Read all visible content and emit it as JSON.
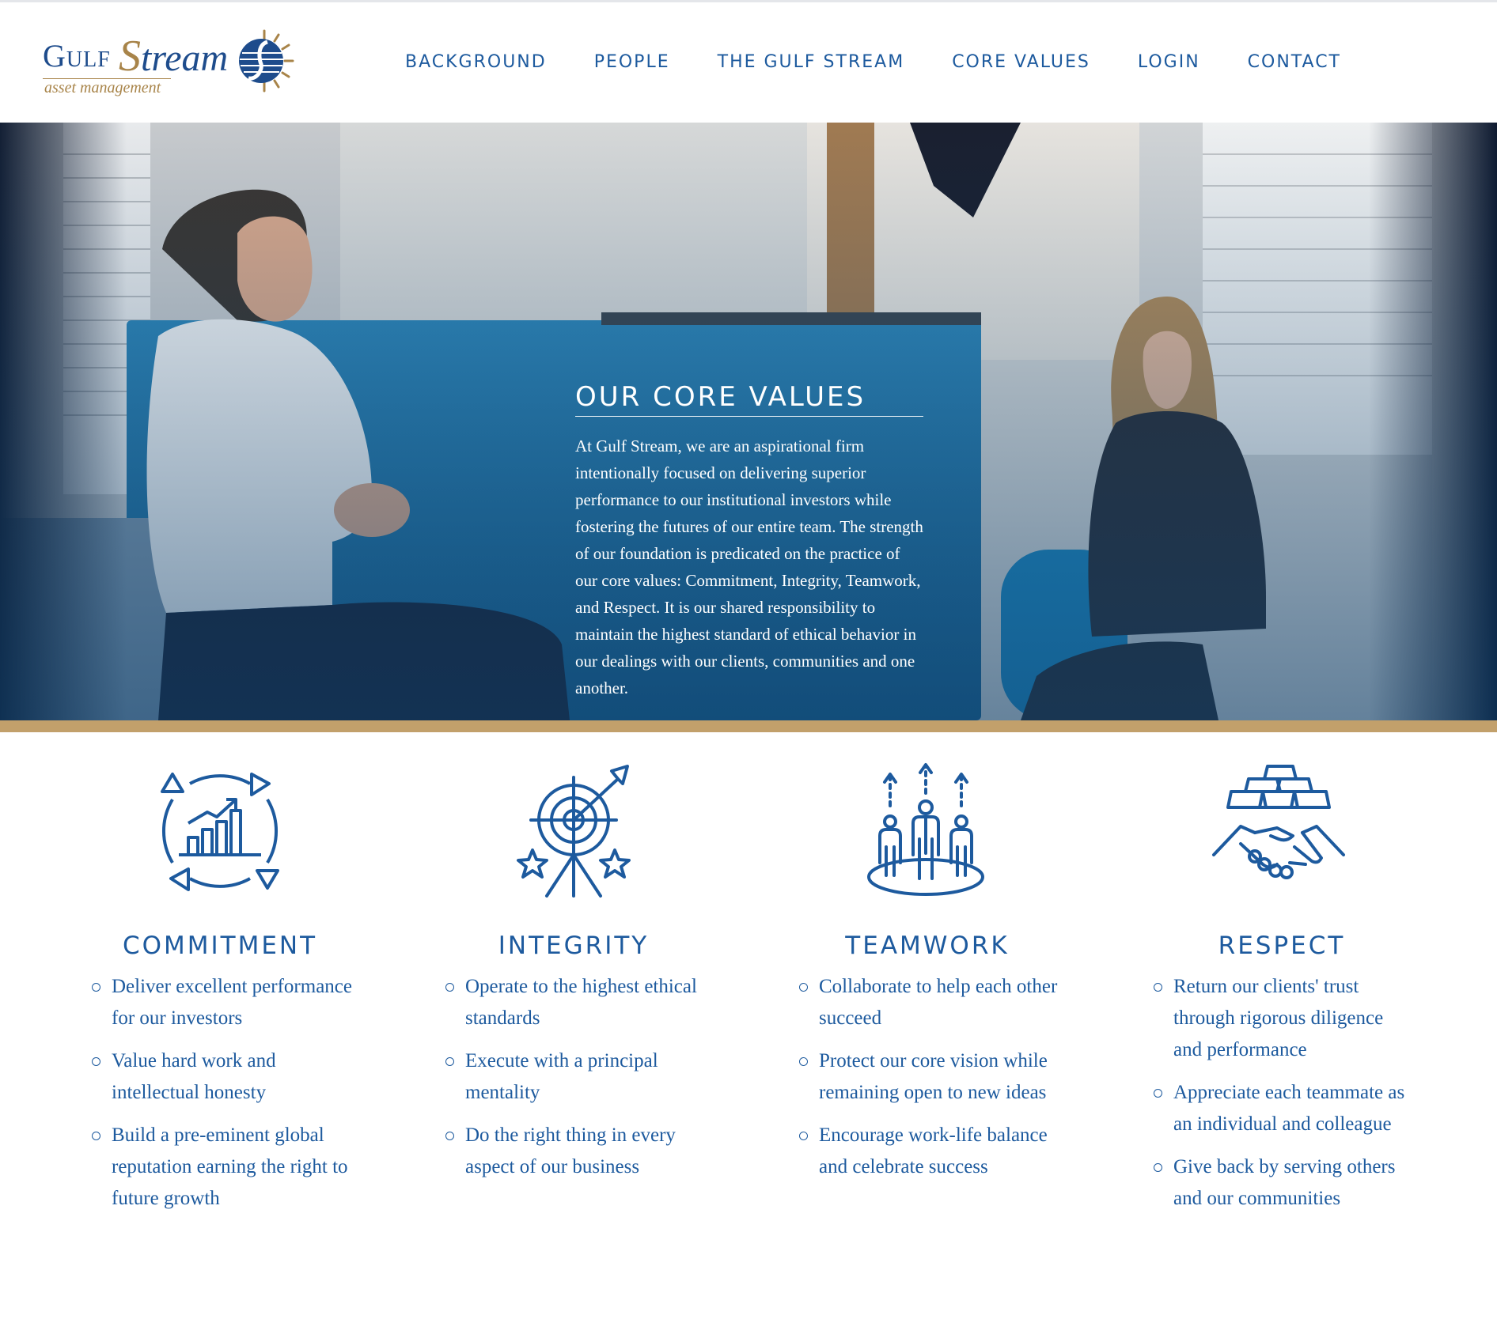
{
  "brand": {
    "name_part1": "Gulf",
    "name_part2": "tream",
    "name_initial": "S",
    "tagline": "asset management",
    "logo_icon": "sun-globe-logo-icon",
    "colors": {
      "navy": "#1e4c8c",
      "gold": "#a88449"
    }
  },
  "nav": {
    "items": [
      {
        "label": "BACKGROUND"
      },
      {
        "label": "PEOPLE"
      },
      {
        "label": "THE GULF STREAM"
      },
      {
        "label": "CORE VALUES"
      },
      {
        "label": "LOGIN"
      },
      {
        "label": "CONTACT"
      }
    ]
  },
  "hero": {
    "title": "OUR CORE VALUES",
    "text": "At Gulf Stream, we are an aspirational firm intentionally focused on delivering superior performance to our institutional investors while fostering the futures of our entire team. The strength of our foundation is predicated on the practice of our core values: Commitment, Integrity, Teamwork, and Respect. It is our shared responsibility to maintain the highest standard of ethical behavior in our dealings with our clients, communities and one another.",
    "image": "photo of man and woman in conversation in an office"
  },
  "accent_color": "#c2a06b",
  "values": [
    {
      "icon": "growth-chart-cycle-icon",
      "title": "COMMITMENT",
      "items": [
        "Deliver excellent performance for our investors",
        "Value hard work and intellectual honesty",
        "Build a pre-eminent global reputation earning the right to future growth"
      ]
    },
    {
      "icon": "target-arrow-stars-icon",
      "title": "INTEGRITY",
      "items": [
        "Operate to the highest ethical standards",
        "Execute with a principal mentality",
        "Do the right thing in every aspect of our business"
      ]
    },
    {
      "icon": "team-rising-icon",
      "title": "TEAMWORK",
      "items": [
        "Collaborate to help each other succeed",
        "Protect our core vision while remaining open to new ideas",
        "Encourage work-life balance and celebrate success"
      ]
    },
    {
      "icon": "handshake-gold-bars-icon",
      "title": "RESPECT",
      "items": [
        "Return our clients' trust through rigorous diligence and performance",
        "Appreciate each teammate as an individual and colleague",
        "Give back by serving others and our communities"
      ]
    }
  ]
}
